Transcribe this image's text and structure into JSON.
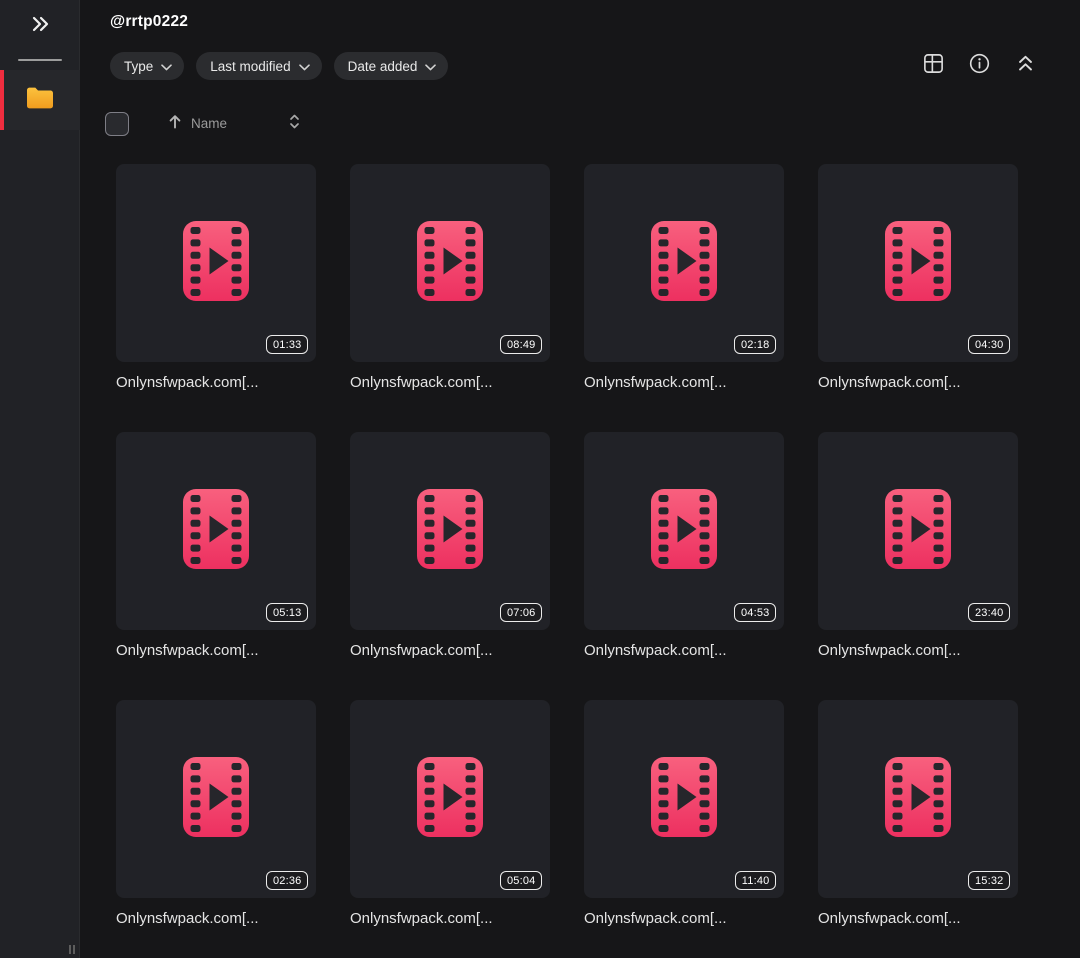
{
  "window": {
    "title": "@rrtp0222"
  },
  "sidebar": {
    "collapse_icon": "chevrons-right-icon",
    "items": [
      {
        "id": "folder",
        "icon": "folder-icon",
        "active": true
      }
    ],
    "resize_handle": "sidebar-resize-handle"
  },
  "toolbar": {
    "filters": [
      {
        "label": "Type"
      },
      {
        "label": "Last modified"
      },
      {
        "label": "Date added"
      }
    ],
    "view_icons": [
      "grid-view-icon",
      "info-icon",
      "collapse-up-icon"
    ]
  },
  "sort_row": {
    "checkbox_checked": false,
    "sort_direction": "ascending",
    "sort_label": "Name"
  },
  "grid": {
    "items": [
      {
        "name": "Onlynsfwpack.com[...",
        "duration": "01:33"
      },
      {
        "name": "Onlynsfwpack.com[...",
        "duration": "08:49"
      },
      {
        "name": "Onlynsfwpack.com[...",
        "duration": "02:18"
      },
      {
        "name": "Onlynsfwpack.com[...",
        "duration": "04:30"
      },
      {
        "name": "Onlynsfwpack.com[...",
        "duration": "05:13"
      },
      {
        "name": "Onlynsfwpack.com[...",
        "duration": "07:06"
      },
      {
        "name": "Onlynsfwpack.com[...",
        "duration": "04:53"
      },
      {
        "name": "Onlynsfwpack.com[...",
        "duration": "23:40"
      },
      {
        "name": "Onlynsfwpack.com[...",
        "duration": "02:36"
      },
      {
        "name": "Onlynsfwpack.com[...",
        "duration": "05:04"
      },
      {
        "name": "Onlynsfwpack.com[...",
        "duration": "11:40"
      },
      {
        "name": "Onlynsfwpack.com[...",
        "duration": "15:32"
      }
    ]
  },
  "colors": {
    "accent_red": "#ef2d3f",
    "folder_top": "#fcc23e",
    "folder_bottom": "#f09c1e",
    "video_pink_top": "#f8607e",
    "video_pink_bottom": "#ed3060",
    "badge_border": "#ececec"
  }
}
